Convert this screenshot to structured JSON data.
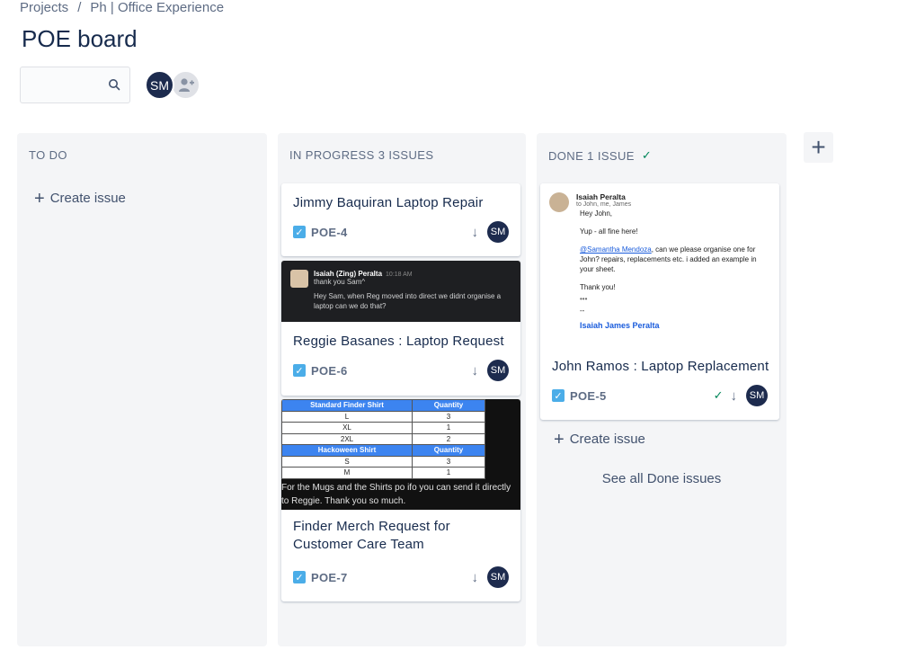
{
  "breadcrumb": {
    "projects": "Projects",
    "sep": "/",
    "project": "Ph | Office Experience"
  },
  "board": {
    "title": "POE board"
  },
  "search": {
    "placeholder": "",
    "value": ""
  },
  "avatars": {
    "main_initials": "SM"
  },
  "columns": {
    "todo": {
      "title": "TO DO",
      "create_label": "Create issue"
    },
    "progress": {
      "title": "IN PROGRESS 3 ISSUES"
    },
    "done": {
      "title": "DONE 1 ISSUE",
      "create_label": "Create issue",
      "see_all": "See all Done issues"
    }
  },
  "cards": [
    {
      "title": "Jimmy Baquiran Laptop Repair",
      "key": "POE-4",
      "assignee": "SM"
    },
    {
      "title": "Reggie Basanes : Laptop Request",
      "key": "POE-6",
      "assignee": "SM",
      "thumb": {
        "name": "Isaiah (Zing) Peralta",
        "time": "10:18 AM",
        "line1": "thank you Sam^",
        "line2": "Hey Sam, when Reg moved into direct we didnt organise a laptop can we do that?"
      }
    },
    {
      "title_line1": "Finder Merch Request for",
      "title_line2": "Customer Care Team",
      "key": "POE-7",
      "assignee": "SM",
      "sheet": {
        "header1": [
          "Standard Finder Shirt",
          "Quantity"
        ],
        "rows1": [
          [
            "L",
            "3"
          ],
          [
            "XL",
            "1"
          ],
          [
            "2XL",
            "2"
          ]
        ],
        "header2": [
          "Hackoween Shirt",
          "Quantity"
        ],
        "rows2": [
          [
            "S",
            "3"
          ],
          [
            "M",
            "1"
          ]
        ],
        "note": "For the Mugs and the Shirts po ifo you can send it directly to Reggie. Thank you so much."
      }
    },
    {
      "title": "John Ramos : Laptop Replacement",
      "key": "POE-5",
      "assignee": "SM",
      "email": {
        "sender": "Isaiah Peralta",
        "to": "to John, me, James",
        "greeting": "Hey John,",
        "line1": "Yup - all fine here!",
        "mention": "@Samantha Mendoza",
        "line2": ", can we please organise one for John? repairs, replacements etc. i added an example in your sheet.",
        "thanks": "Thank you!",
        "dots": "•••",
        "dash": "--",
        "signature": "Isaiah James Peralta"
      }
    }
  ],
  "colors": {
    "accent": "#0052cc",
    "done": "#00875a",
    "story": "#4bade8",
    "avatar": "#1d2b4e"
  }
}
